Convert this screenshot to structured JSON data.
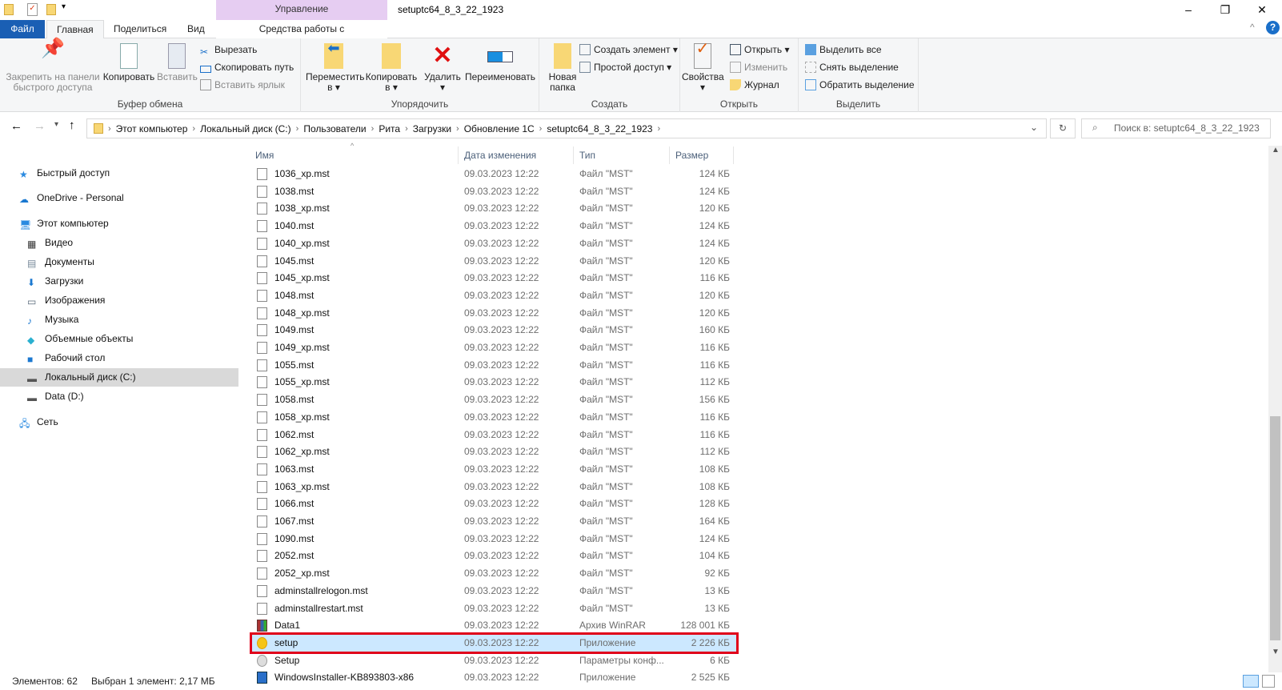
{
  "window": {
    "title": "setuptc64_8_3_22_1923",
    "context_tab": "Управление",
    "minimize": "–",
    "restore": "❐",
    "close": "✕"
  },
  "tabs": [
    "Файл",
    "Главная",
    "Поделиться",
    "Вид",
    "Средства работы с приложениями"
  ],
  "ribbon": {
    "clipboard": {
      "label": "Буфер обмена",
      "pin": "Закрепить на панели быстрого доступа",
      "copy": "Копировать",
      "paste": "Вставить",
      "cut": "Вырезать",
      "copy_path": "Скопировать путь",
      "paste_shortcut": "Вставить ярлык"
    },
    "organize": {
      "label": "Упорядочить",
      "move": "Переместить в",
      "copyto": "Копировать в",
      "delete": "Удалить",
      "rename": "Переименовать"
    },
    "create": {
      "label": "Создать",
      "new_folder": "Новая папка",
      "new_item": "Создать элемент ▾",
      "easy_access": "Простой доступ ▾"
    },
    "open": {
      "label": "Открыть",
      "properties": "Свойства",
      "open": "Открыть ▾",
      "edit": "Изменить",
      "history": "Журнал"
    },
    "select": {
      "label": "Выделить",
      "all": "Выделить все",
      "none": "Снять выделение",
      "invert": "Обратить выделение"
    }
  },
  "address": {
    "crumbs": [
      "Этот компьютер",
      "Локальный диск (C:)",
      "Пользователи",
      "Рита",
      "Загрузки",
      "Обновление 1С",
      "setuptc64_8_3_22_1923"
    ],
    "search_placeholder": "Поиск в: setuptc64_8_3_22_1923"
  },
  "nav": [
    {
      "label": "Быстрый доступ",
      "icon": "star-icon",
      "level": 0
    },
    {
      "label": "OneDrive - Personal",
      "icon": "cloud-icon",
      "level": 0
    },
    {
      "label": "Этот компьютер",
      "icon": "computer-icon",
      "level": 0
    },
    {
      "label": "Видео",
      "icon": "video-icon",
      "level": 1
    },
    {
      "label": "Документы",
      "icon": "documents-icon",
      "level": 1
    },
    {
      "label": "Загрузки",
      "icon": "downloads-icon",
      "level": 1
    },
    {
      "label": "Изображения",
      "icon": "pictures-icon",
      "level": 1
    },
    {
      "label": "Музыка",
      "icon": "music-icon",
      "level": 1
    },
    {
      "label": "Объемные объекты",
      "icon": "3d-objects-icon",
      "level": 1
    },
    {
      "label": "Рабочий стол",
      "icon": "desktop-icon",
      "level": 1
    },
    {
      "label": "Локальный диск (C:)",
      "icon": "drive-icon",
      "level": 1,
      "selected": true
    },
    {
      "label": "Data (D:)",
      "icon": "drive-icon",
      "level": 1
    },
    {
      "label": "Сеть",
      "icon": "network-icon",
      "level": 0
    }
  ],
  "columns": [
    "Имя",
    "Дата изменения",
    "Тип",
    "Размер"
  ],
  "files": [
    [
      "1036_xp.mst",
      "09.03.2023 12:22",
      "Файл \"MST\"",
      "124 КБ",
      "file"
    ],
    [
      "1038.mst",
      "09.03.2023 12:22",
      "Файл \"MST\"",
      "124 КБ",
      "file"
    ],
    [
      "1038_xp.mst",
      "09.03.2023 12:22",
      "Файл \"MST\"",
      "120 КБ",
      "file"
    ],
    [
      "1040.mst",
      "09.03.2023 12:22",
      "Файл \"MST\"",
      "124 КБ",
      "file"
    ],
    [
      "1040_xp.mst",
      "09.03.2023 12:22",
      "Файл \"MST\"",
      "124 КБ",
      "file"
    ],
    [
      "1045.mst",
      "09.03.2023 12:22",
      "Файл \"MST\"",
      "120 КБ",
      "file"
    ],
    [
      "1045_xp.mst",
      "09.03.2023 12:22",
      "Файл \"MST\"",
      "116 КБ",
      "file"
    ],
    [
      "1048.mst",
      "09.03.2023 12:22",
      "Файл \"MST\"",
      "120 КБ",
      "file"
    ],
    [
      "1048_xp.mst",
      "09.03.2023 12:22",
      "Файл \"MST\"",
      "120 КБ",
      "file"
    ],
    [
      "1049.mst",
      "09.03.2023 12:22",
      "Файл \"MST\"",
      "160 КБ",
      "file"
    ],
    [
      "1049_xp.mst",
      "09.03.2023 12:22",
      "Файл \"MST\"",
      "116 КБ",
      "file"
    ],
    [
      "1055.mst",
      "09.03.2023 12:22",
      "Файл \"MST\"",
      "116 КБ",
      "file"
    ],
    [
      "1055_xp.mst",
      "09.03.2023 12:22",
      "Файл \"MST\"",
      "112 КБ",
      "file"
    ],
    [
      "1058.mst",
      "09.03.2023 12:22",
      "Файл \"MST\"",
      "156 КБ",
      "file"
    ],
    [
      "1058_xp.mst",
      "09.03.2023 12:22",
      "Файл \"MST\"",
      "116 КБ",
      "file"
    ],
    [
      "1062.mst",
      "09.03.2023 12:22",
      "Файл \"MST\"",
      "116 КБ",
      "file"
    ],
    [
      "1062_xp.mst",
      "09.03.2023 12:22",
      "Файл \"MST\"",
      "112 КБ",
      "file"
    ],
    [
      "1063.mst",
      "09.03.2023 12:22",
      "Файл \"MST\"",
      "108 КБ",
      "file"
    ],
    [
      "1063_xp.mst",
      "09.03.2023 12:22",
      "Файл \"MST\"",
      "108 КБ",
      "file"
    ],
    [
      "1066.mst",
      "09.03.2023 12:22",
      "Файл \"MST\"",
      "128 КБ",
      "file"
    ],
    [
      "1067.mst",
      "09.03.2023 12:22",
      "Файл \"MST\"",
      "164 КБ",
      "file"
    ],
    [
      "1090.mst",
      "09.03.2023 12:22",
      "Файл \"MST\"",
      "124 КБ",
      "file"
    ],
    [
      "2052.mst",
      "09.03.2023 12:22",
      "Файл \"MST\"",
      "104 КБ",
      "file"
    ],
    [
      "2052_xp.mst",
      "09.03.2023 12:22",
      "Файл \"MST\"",
      "92 КБ",
      "file"
    ],
    [
      "adminstallrelogon.mst",
      "09.03.2023 12:22",
      "Файл \"MST\"",
      "13 КБ",
      "file"
    ],
    [
      "adminstallrestart.mst",
      "09.03.2023 12:22",
      "Файл \"MST\"",
      "13 КБ",
      "file"
    ],
    [
      "Data1",
      "09.03.2023 12:22",
      "Архив WinRAR",
      "128 001 КБ",
      "rar"
    ],
    [
      "setup",
      "09.03.2023 12:22",
      "Приложение",
      "2 226 КБ",
      "1c"
    ],
    [
      "Setup",
      "09.03.2023 12:22",
      "Параметры конф...",
      "6 КБ",
      "ini"
    ],
    [
      "WindowsInstaller-KB893803-x86",
      "09.03.2023 12:22",
      "Приложение",
      "2 525 КБ",
      "exe"
    ]
  ],
  "selected_index": 27,
  "status": {
    "count": "Элементов: 62",
    "selection": "Выбран 1 элемент: 2,17 МБ"
  }
}
